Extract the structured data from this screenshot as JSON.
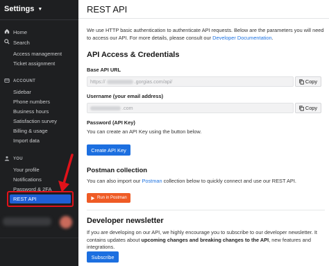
{
  "sidebar": {
    "title": "Settings",
    "items": {
      "home": "Home",
      "search": "Search",
      "access_management": "Access management",
      "ticket_assignment": "Ticket assignment",
      "account_section": "ACCOUNT",
      "sidebar": "Sidebar",
      "phone_numbers": "Phone numbers",
      "business_hours": "Business hours",
      "satisfaction_survey": "Satisfaction survey",
      "billing_usage": "Billing & usage",
      "import_data": "Import data",
      "you_section": "YOU",
      "your_profile": "Your profile",
      "notifications": "Notifications",
      "password_2fa": "Password & 2FA",
      "rest_api": "REST API"
    }
  },
  "main": {
    "title": "REST API",
    "intro_text": "We use HTTP basic authentication to authenticate API requests. Below are the parameters you will need to access our API. For more details, please consult our ",
    "intro_link": "Developer Documentation",
    "intro_end": ".",
    "credentials_heading": "API Access & Credentials",
    "base_url_label": "Base API URL",
    "base_url_prefix": "https://",
    "base_url_suffix": ".gorgias.com/api/",
    "username_label": "Username (your email address)",
    "username_suffix": ".com",
    "copy_label": "Copy",
    "password_label": "Password (API Key)",
    "password_help": "You can create an API Key using the button below.",
    "create_key_button": "Create API Key",
    "postman_heading": "Postman collection",
    "postman_text_start": "You can also import our ",
    "postman_link": "Postman",
    "postman_text_end": " collection below to quickly connect and use our REST API.",
    "run_postman_button": "Run in Postman",
    "newsletter_heading": "Developer newsletter",
    "newsletter_text_1": "If you are developing on our API, we highly encourage you to subscribe to our developer newsletter. It contains updates about ",
    "newsletter_bold": "upcoming changes and breaking changes to the API",
    "newsletter_text_2": ", new features and integrations.",
    "subscribe_button": "Subscribe"
  },
  "colors": {
    "sidebar_bg": "#1e1f21",
    "accent": "#1c6fe0",
    "postman": "#ef5b25",
    "highlight": "#e0121a"
  }
}
